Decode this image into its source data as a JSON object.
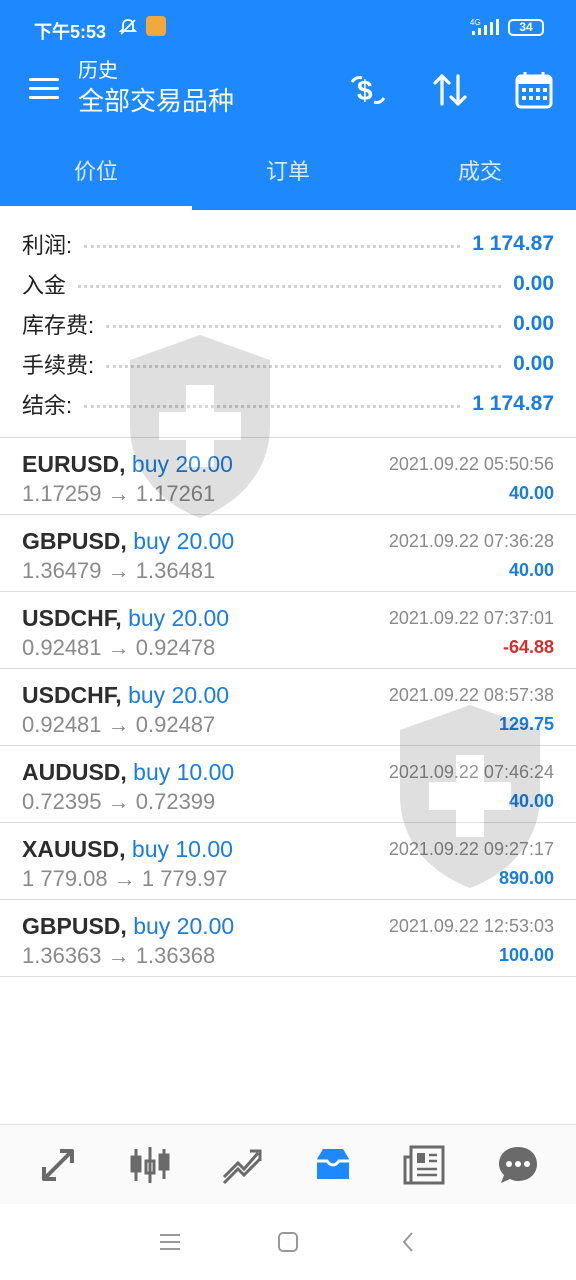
{
  "status": {
    "time": "下午5:53",
    "network": "4G",
    "battery": "34"
  },
  "toolbar": {
    "subtitle": "历史",
    "title": "全部交易品种",
    "icons": [
      "menu-icon",
      "dollar-swap-icon",
      "sort-icon",
      "calendar-icon"
    ]
  },
  "tabs": [
    {
      "label": "价位",
      "active": true
    },
    {
      "label": "订单",
      "active": false
    },
    {
      "label": "成交",
      "active": false
    }
  ],
  "summary": [
    {
      "label": "利润:",
      "value": "1 174.87"
    },
    {
      "label": "入金",
      "value": "0.00"
    },
    {
      "label": "库存费:",
      "value": "0.00"
    },
    {
      "label": "手续费:",
      "value": "0.00"
    },
    {
      "label": "结余:",
      "value": "1 174.87"
    }
  ],
  "trades": [
    {
      "symbol": "EURUSD,",
      "type": "buy 20.00",
      "prices": "1.17259 → 1.17261",
      "time": "2021.09.22 05:50:56",
      "profit": "40.00"
    },
    {
      "symbol": "GBPUSD,",
      "type": "buy 20.00",
      "prices": "1.36479 → 1.36481",
      "time": "2021.09.22 07:36:28",
      "profit": "40.00"
    },
    {
      "symbol": "USDCHF,",
      "type": "buy 20.00",
      "prices": "0.92481 → 0.92478",
      "time": "2021.09.22 07:37:01",
      "profit": "-64.88"
    },
    {
      "symbol": "USDCHF,",
      "type": "buy 20.00",
      "prices": "0.92481 → 0.92487",
      "time": "2021.09.22 08:57:38",
      "profit": "129.75"
    },
    {
      "symbol": "AUDUSD,",
      "type": "buy 10.00",
      "prices": "0.72395 → 0.72399",
      "time": "2021.09.22 07:46:24",
      "profit": "40.00"
    },
    {
      "symbol": "XAUUSD,",
      "type": "buy 10.00",
      "prices": "1 779.08 → 1 779.97",
      "time": "2021.09.22 09:27:17",
      "profit": "890.00"
    },
    {
      "symbol": "GBPUSD,",
      "type": "buy 20.00",
      "prices": "1.36363 → 1.36368",
      "time": "2021.09.22 12:53:03",
      "profit": "100.00"
    }
  ],
  "bottom_nav": {
    "items": [
      "quotes-icon",
      "chart-icon",
      "trade-icon",
      "history-icon",
      "news-icon",
      "chat-icon"
    ],
    "active": "history-icon"
  },
  "system_nav": [
    "recents-icon",
    "home-icon",
    "back-icon"
  ],
  "colors": {
    "accent": "#1e88ff",
    "value_blue": "#1b7de0",
    "negative_red": "#d32f2f"
  }
}
